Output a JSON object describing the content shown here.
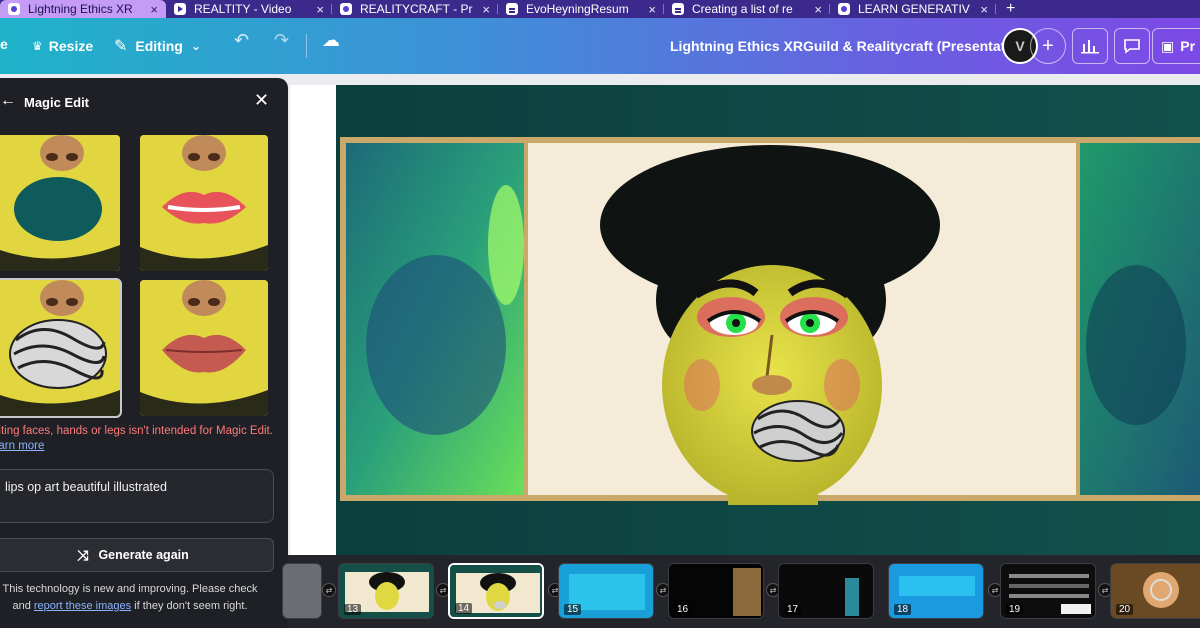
{
  "browser": {
    "tabs": [
      {
        "label": "Lightning Ethics XR",
        "favicon": "canva-icon",
        "active": true
      },
      {
        "label": "REALTITY - Video",
        "favicon": "video-icon",
        "active": false
      },
      {
        "label": "REALITYCRAFT - Pr",
        "favicon": "canva-icon",
        "active": false
      },
      {
        "label": "EvoHeyningResum",
        "favicon": "doc-icon",
        "active": false
      },
      {
        "label": "Creating a list of re",
        "favicon": "doc-icon",
        "active": false
      },
      {
        "label": "LEARN GENERATIV",
        "favicon": "canva-icon",
        "active": false
      }
    ],
    "close_glyph": "×",
    "new_tab_glyph": "+"
  },
  "toolbar": {
    "file_label": "e",
    "resize_label": "Resize",
    "editing_label": "Editing",
    "presentation_title": "Lightning Ethics XRGuild & Realitycraft (Presentation)",
    "avatar_text": "V",
    "present_label": "Pr",
    "accent_start": "#1fb3c9",
    "accent_end": "#7d49e6"
  },
  "magic_edit": {
    "title": "Magic Edit",
    "warning": "diting faces, hands or legs isn't intended for Magic Edit.",
    "learn_more": "earn more",
    "prompt_value": "lips op art beautiful illustrated",
    "generate_label": "Generate again",
    "disclaimer_pre": "This technology is new and improving. Please check and",
    "disclaimer_link": "report these images",
    "disclaimer_post": "if they don't seem right.",
    "warning_color": "#ff7a7a",
    "link_color": "#8bb4ff"
  },
  "filmstrip": {
    "pages": [
      {
        "number": "13",
        "selected": false
      },
      {
        "number": "14",
        "selected": true
      },
      {
        "number": "15",
        "selected": false
      },
      {
        "number": "16",
        "selected": false
      },
      {
        "number": "17",
        "selected": false
      },
      {
        "number": "18",
        "selected": false
      },
      {
        "number": "19",
        "selected": false
      },
      {
        "number": "20",
        "selected": false
      }
    ]
  }
}
